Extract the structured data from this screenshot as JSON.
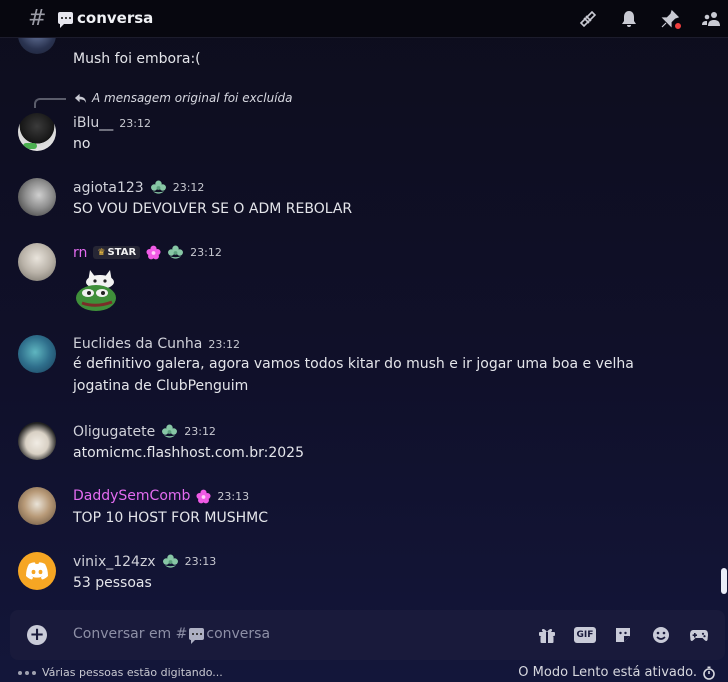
{
  "header": {
    "hash": "#",
    "channel": "conversa",
    "icons": [
      "threads-icon",
      "bell-icon",
      "pin-icon",
      "members-icon"
    ]
  },
  "messages": [
    {
      "author": "",
      "time": "",
      "text": "Mush foi embora:("
    },
    {
      "reply_text": "A mensagem original foi excluída",
      "author": "iBlu__",
      "time": "23:12",
      "text": "no"
    },
    {
      "author": "agiota123",
      "time": "23:12",
      "text": "SO VOU DEVOLVER SE O ADM REBOLAR"
    },
    {
      "author": "rn",
      "tag": "STAR",
      "time": "23:12",
      "text": "",
      "sticker": "pepe-sticker"
    },
    {
      "author": "Euclides da Cunha",
      "time": "23:12",
      "text": "é definitivo galera, agora vamos todos kitar do mush e ir jogar uma boa e velha jogatina de ClubPenguim"
    },
    {
      "author": "Oligugatete",
      "time": "23:12",
      "text": "atomicmc.flashhost.com.br:2025"
    },
    {
      "author": "DaddySemComb",
      "time": "23:13",
      "text": "TOP 10 HOST FOR MUSHMC"
    },
    {
      "author": "vinix_124zx",
      "time": "23:13",
      "text": "53 pessoas"
    }
  ],
  "composer": {
    "placeholder_prefix": "Conversar em #",
    "placeholder_channel": "conversa",
    "gif_label": "GIF"
  },
  "footer": {
    "typing": "Várias pessoas estão digitando...",
    "slowmode": "O Modo Lento está ativado."
  },
  "colors": {
    "pink_name": "#e36bf0",
    "flower_green": "#87c7a5",
    "accent_blue": "#5865f2"
  }
}
